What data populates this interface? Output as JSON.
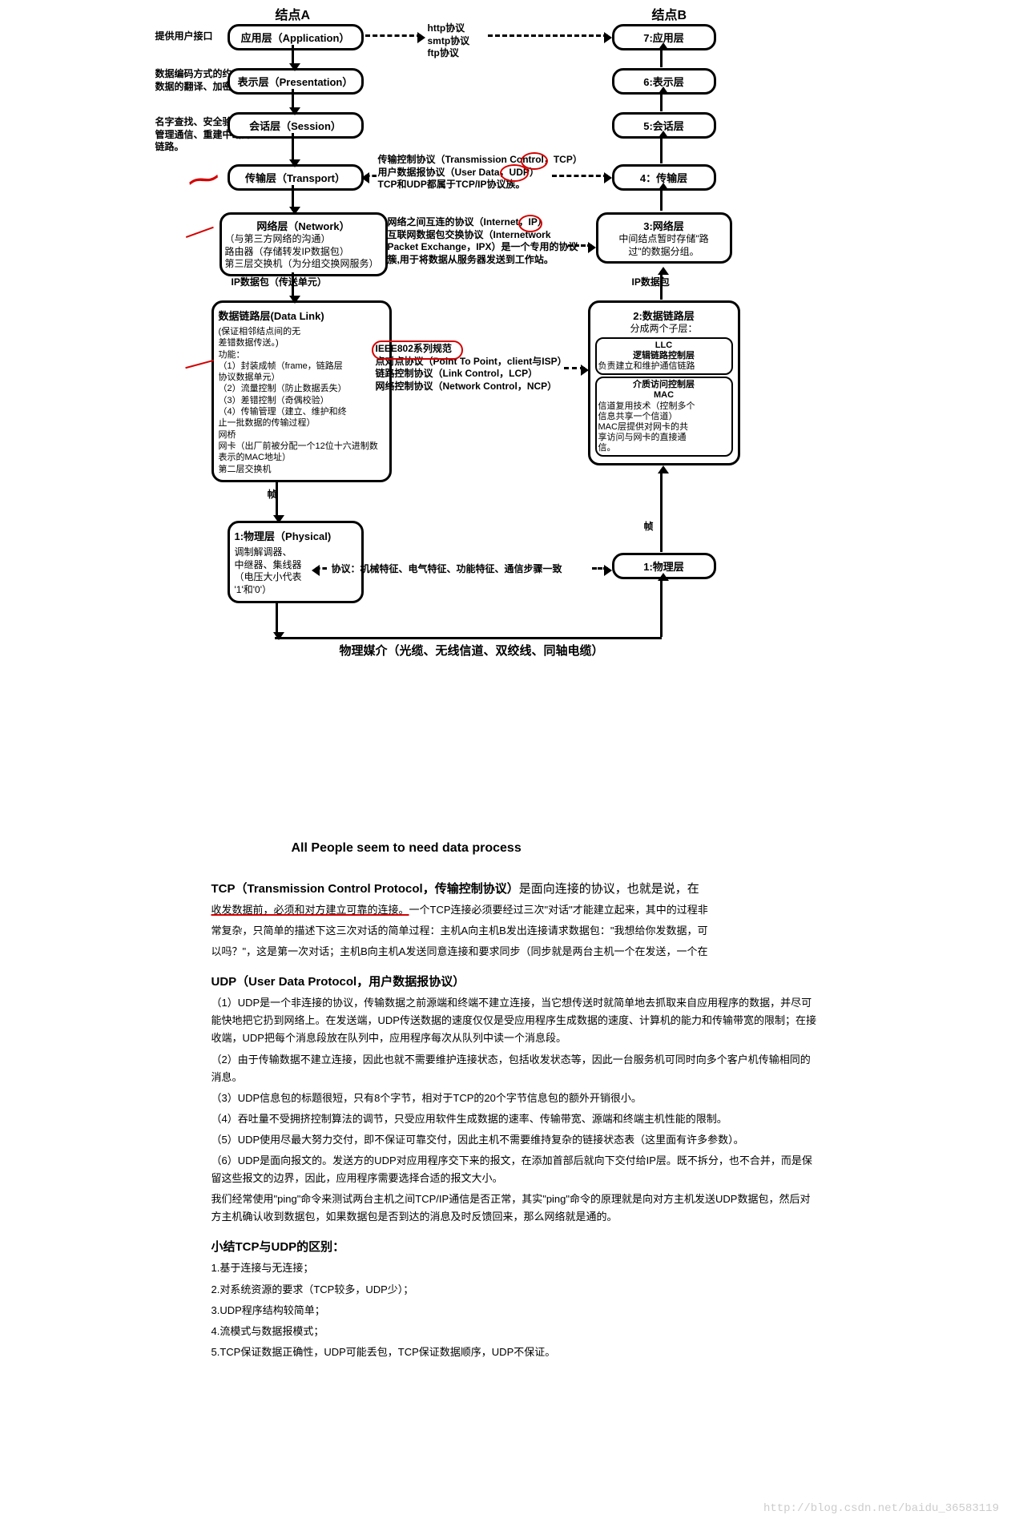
{
  "headers": {
    "nodeA": "结点A",
    "nodeB": "结点B"
  },
  "leftAnnot": {
    "l1": "提供用户接口",
    "l2": "数据编码方式的约定\n数据的翻译、加密、转换",
    "l3": "名字查找、安全验证、\n管理通信、重建中断的\n链路。"
  },
  "boxesA": {
    "app": "应用层（Application）",
    "pres": "表示层（Presentation）",
    "sess": "会话层（Session）",
    "trans": "传输层（Transport）",
    "netTitle": "网络层（Network）",
    "netBody": "（与第三方网络的沟通）\n路由器（存储转发IP数据包）\n第三层交换机（为分组交换网服务）",
    "ipPkt": "IP数据包（传送单元）",
    "dlTitle": "数据链路层(Data Link)",
    "dlBody": "(保证相邻结点间的无\n差错数据传送。)\n功能：\n（1）封装成帧（frame，链路层\n协议数据单元）\n（2）流量控制（防止数据丢失）\n（3）差错控制（奇偶校验）\n（4）传输管理（建立、维护和终\n止一批数据的传输过程）\n网桥\n网卡（出厂前被分配一个12位十六进制数表示的MAC地址）\n第二层交换机",
    "frame": "帧",
    "phyTitle": "1:物理层（Physical)",
    "phyBody": "调制解调器、\n中继器、集线器\n（电压大小代表\n'1'和'0'）"
  },
  "boxesB": {
    "l7": "7:应用层",
    "l6": "6:表示层",
    "l5": "5:会话层",
    "l4": "4：传输层",
    "l3Title": "3:网络层",
    "l3Body": "中间结点暂时存储\"路\n过\"的数据分组。",
    "ipPkt": "IP数据包",
    "l2Title": "2:数据链路层",
    "l2Sub": "分成两个子层：",
    "llcTitle": "LLC\n逻辑链路控制层",
    "llcBody": "负责建立和维护通信链路",
    "macTitle": "介质访问控制层\nMAC",
    "macBody": "信道复用技术（控制多个\n信息共享一个信道）\nMAC层提供对网卡的共\n享访问与网卡的直接通\n信。",
    "frame": "帧",
    "l1": "1:物理层"
  },
  "midProto": {
    "app": "http协议\nsmtp协议\nftp协议",
    "trans": "传输控制协议（Transmission Control，TCP）\n用户数据报协议（User Data，UDP）\n TCP和UDP都属于TCP/IP协议族。",
    "net": "网络之间互连的协议（Internet，IP）\n互联网数据包交换协议（Internetwork\nPacket Exchange，IPX）是一个专用的协议\n簇,用于将数据从服务器发送到工作站。",
    "dl": "IEEE802系列规范\n点对点协议（Point To Point，client与ISP）\n链路控制协议（Link Control，LCP）\n网络控制协议（Network Control，NCP）",
    "phy": "协议：机械特征、电气特征、功能特征、通信步骤一致"
  },
  "bottom": "物理媒介（光缆、无线信道、双绞线、同轴电缆）",
  "mnemonic": "All People seem  to need data process",
  "tcp": {
    "title": "TCP（Transmission Control Protocol，传输控制协议）",
    "titleRest": "是面向连接的协议，也就是说，在",
    "line2a": "收发数据前，必须和对方建立可靠的连接。",
    "line2b": "一个TCP连接必须要经过三次\"对话\"才能建立起来，其中的过程非",
    "line3": "常复杂，只简单的描述下这三次对话的简单过程：主机A向主机B发出连接请求数据包：\"我想给你发数据，可",
    "line4": "以吗？\"，这是第一次对话；主机B向主机A发送同意连接和要求同步（同步就是两台主机一个在发送，一个在"
  },
  "udp": {
    "title": "UDP（User Data Protocol，用户数据报协议）",
    "p1": "（1）UDP是一个非连接的协议，传输数据之前源端和终端不建立连接，当它想传送时就简单地去抓取来自应用程序的数据，并尽可能快地把它扔到网络上。在发送端，UDP传送数据的速度仅仅是受应用程序生成数据的速度、计算机的能力和传输带宽的限制；在接收端，UDP把每个消息段放在队列中，应用程序每次从队列中读一个消息段。",
    "p2": "（2）由于传输数据不建立连接，因此也就不需要维护连接状态，包括收发状态等，因此一台服务机可同时向多个客户机传输相同的消息。",
    "p3": "（3）UDP信息包的标题很短，只有8个字节，相对于TCP的20个字节信息包的额外开销很小。",
    "p4": "（4）吞吐量不受拥挤控制算法的调节，只受应用软件生成数据的速率、传输带宽、源端和终端主机性能的限制。",
    "p5": "（5）UDP使用尽最大努力交付，即不保证可靠交付，因此主机不需要维持复杂的链接状态表（这里面有许多参数）。",
    "p6": "（6）UDP是面向报文的。发送方的UDP对应用程序交下来的报文，在添加首部后就向下交付给IP层。既不拆分，也不合并，而是保留这些报文的边界，因此，应用程序需要选择合适的报文大小。",
    "p7": "我们经常使用\"ping\"命令来测试两台主机之间TCP/IP通信是否正常，其实\"ping\"命令的原理就是向对方主机发送UDP数据包，然后对方主机确认收到数据包，如果数据包是否到达的消息及时反馈回来，那么网络就是通的。"
  },
  "summary": {
    "title": "小结TCP与UDP的区别：",
    "s1": "1.基于连接与无连接；",
    "s2": "2.对系统资源的要求（TCP较多，UDP少）；",
    "s3": "3.UDP程序结构较简单；",
    "s4": "4.流模式与数据报模式；",
    "s5": "5.TCP保证数据正确性，UDP可能丢包，TCP保证数据顺序，UDP不保证。"
  },
  "watermark": "http://blog.csdn.net/baidu_36583119"
}
